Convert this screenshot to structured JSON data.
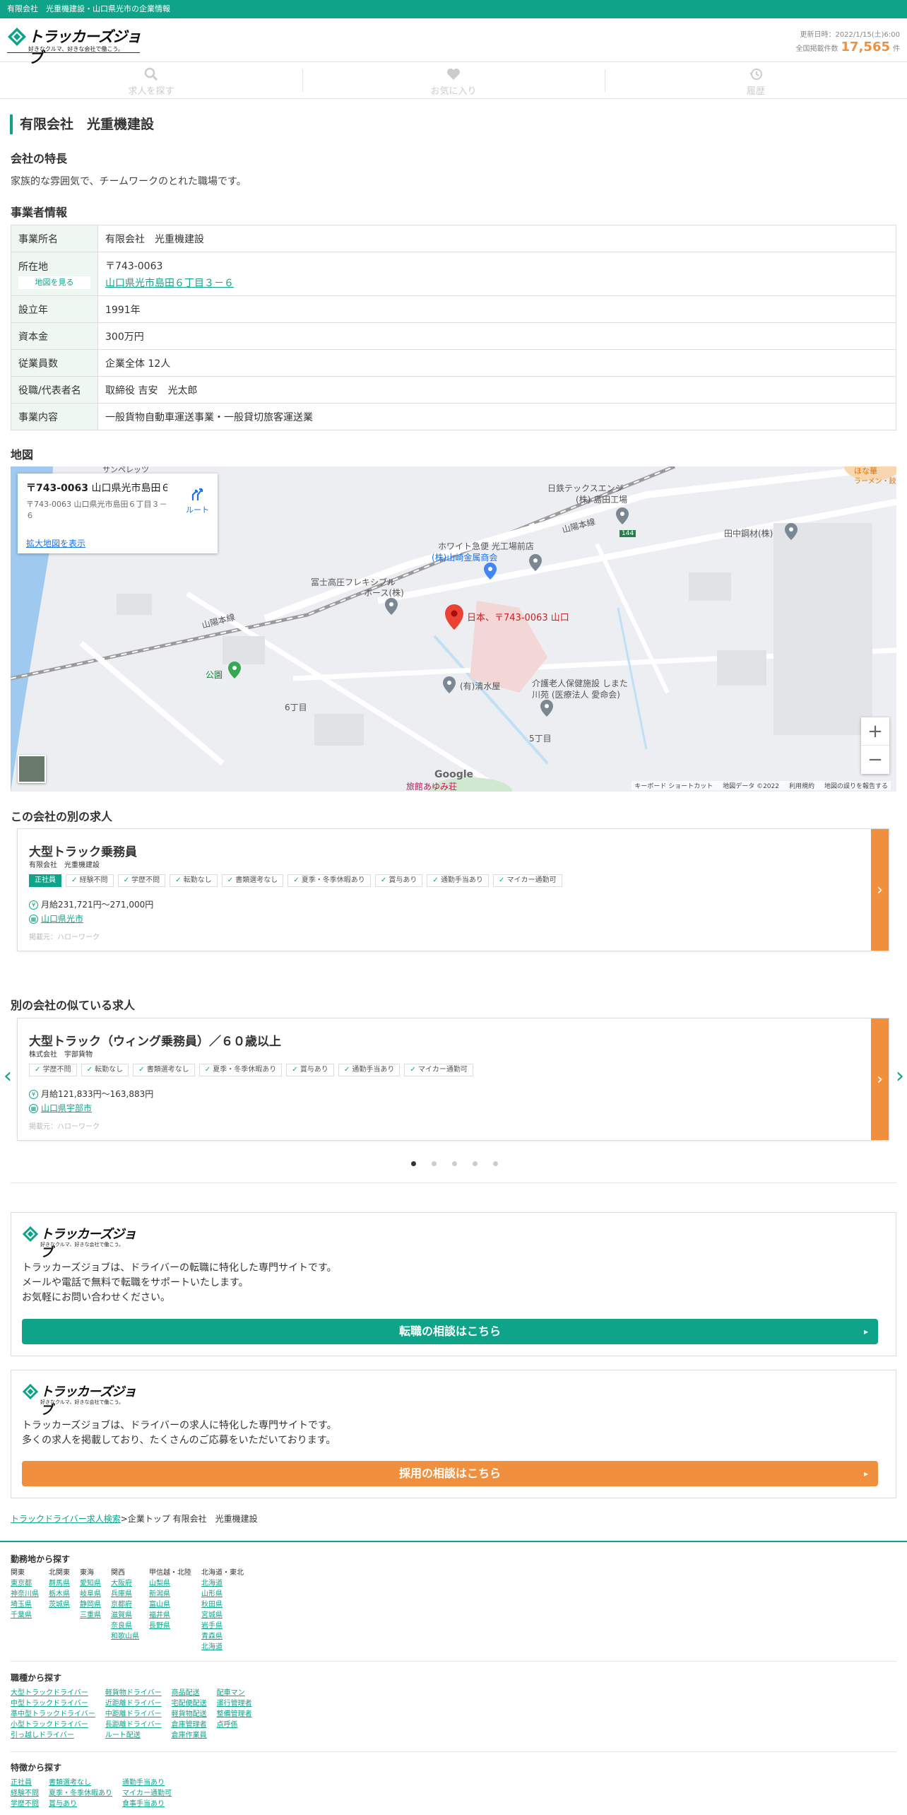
{
  "topbar": {
    "text": "有限会社　光重機建設・山口県光市の企業情報"
  },
  "header": {
    "logo_text": "トラッカーズジョブ",
    "logo_tagline": "好きなクルマ、好きな会社で働こう。",
    "updated": "更新日時：2022/1/15(土)6:00",
    "count_label": "全国掲載件数",
    "count_value": "17,565",
    "count_unit": "件"
  },
  "nav": [
    {
      "label": "求人を探す",
      "icon": "search-icon"
    },
    {
      "label": "お気に入り",
      "icon": "heart-icon"
    },
    {
      "label": "履歴",
      "icon": "history-icon"
    }
  ],
  "company": {
    "title": "有限会社　光重機建設",
    "feature_heading": "会社の特長",
    "feature_text": "家族的な雰囲気で、チームワークのとれた職場です。",
    "info_heading": "事業者情報",
    "rows": [
      {
        "label": "事業所名",
        "value": "有限会社　光重機建設"
      },
      {
        "label": "所在地",
        "postal": "〒743-0063",
        "address": "山口県光市島田６丁目３－６",
        "map_button": "地図を見る"
      },
      {
        "label": "設立年",
        "value": "1991年"
      },
      {
        "label": "資本金",
        "value": "300万円"
      },
      {
        "label": "従業員数",
        "value": "企業全体 12人"
      },
      {
        "label": "役職/代表者名",
        "value": "取締役 吉安　光太郎"
      },
      {
        "label": "事業内容",
        "value": "一般貨物自動車運送事業・一般貸切旅客運送業"
      }
    ]
  },
  "map": {
    "heading": "地図",
    "card_title_bold": "〒743-0063",
    "card_title_rest": " 山口県光市島田６...",
    "card_address": "〒743-0063 山口県光市島田６丁目３－６",
    "route": "ルート",
    "enlarge": "拡大地図を表示",
    "pin_label": "日本、〒743-0063 山口",
    "labels": {
      "nittetsu": "日鉄テックスエンジ",
      "nittetsu2": "(株) 島田工場",
      "white": "ホワイト急便 光工場前店",
      "yamasaki": "(株)山崎金属商会",
      "fuji": "冨士高圧フレキシブル",
      "fuji2": "ホース(株)",
      "tanaka": "田中鋼材(株)",
      "park": "公園",
      "shimizu": "(有)清水屋",
      "kaigo": "介護老人保健施設 しまた",
      "kaigo2": "川苑 (医療法人 愛命会)",
      "chome6": "6丁目",
      "chome5": "5丁目",
      "line1": "山陽本線",
      "line2": "山陽本線",
      "sunpet": "サンペレッツ",
      "ryokan": "旅館あゆみ荘",
      "hotplace": "ほな華",
      "ramen": "ラーメン・餃",
      "route144": "144",
      "google": "Google"
    },
    "attribution": [
      "キーボード ショートカット",
      "地図データ ©2022",
      "利用規約",
      "地図の誤りを報告する"
    ]
  },
  "other_jobs": {
    "heading": "この会社の別の求人",
    "job": {
      "title": "大型トラック乗務員",
      "company": "有限会社　光重機建設",
      "tags": [
        "正社員",
        "経験不問",
        "学歴不問",
        "転勤なし",
        "書類選考なし",
        "夏季・冬季休暇あり",
        "賞与あり",
        "通勤手当あり",
        "マイカー通勤可"
      ],
      "salary": "月給231,721円〜271,000円",
      "place": "山口県光市",
      "source": "掲載元：ハローワーク"
    }
  },
  "similar_jobs": {
    "heading": "別の会社の似ている求人",
    "job": {
      "title": "大型トラック（ウィング乗務員）／６０歳以上",
      "company": "株式会社　宇部貨物",
      "tags": [
        "学歴不問",
        "転勤なし",
        "書類選考なし",
        "夏季・冬季休暇あり",
        "賞与あり",
        "通勤手当あり",
        "マイカー通勤可"
      ],
      "salary": "月給121,833円〜163,883円",
      "place": "山口県宇部市",
      "source": "掲載元：ハローワーク"
    }
  },
  "promo1": {
    "lines": [
      "トラッカーズジョブは、ドライバーの転職に特化した専門サイトです。",
      "メールや電話で無料で転職をサポートいたします。",
      "お気軽にお問い合わせください。"
    ],
    "button": "転職の相談はこちら"
  },
  "promo2": {
    "lines": [
      "トラッカーズジョブは、ドライバーの求人に特化した専門サイトです。",
      "多くの求人を掲載しており、たくさんのご応募をいただいております。"
    ],
    "button": "採用の相談はこちら"
  },
  "breadcrumb": {
    "link": "トラックドライバー求人検索",
    "rest": ">企業トップ 有限会社　光重機建設"
  },
  "footer": {
    "area_heading": "勤務地から探す",
    "areas": [
      {
        "head": "関東",
        "items": [
          "東京都",
          "神奈川県",
          "埼玉県",
          "千葉県"
        ]
      },
      {
        "head": "北関東",
        "items": [
          "群馬県",
          "栃木県",
          "茨城県"
        ]
      },
      {
        "head": "東海",
        "items": [
          "愛知県",
          "岐阜県",
          "静岡県",
          "三重県"
        ]
      },
      {
        "head": "関西",
        "items": [
          "大阪府",
          "兵庫県",
          "京都府",
          "滋賀県",
          "奈良県",
          "和歌山県"
        ]
      },
      {
        "head": "甲信越・北陸",
        "items": [
          "山梨県",
          "新潟県",
          "富山県",
          "福井県",
          "長野県"
        ]
      },
      {
        "head": "北海道・東北",
        "items": [
          "北海道",
          "山形県",
          "秋田県",
          "宮城県",
          "岩手県",
          "青森県",
          "北海道"
        ]
      }
    ],
    "type_heading": "職種から探す",
    "types": [
      [
        "大型トラックドライバー",
        "中型トラックドライバー",
        "準中型トラックドライバー",
        "小型トラックドライバー",
        "引っ越しドライバー"
      ],
      [
        "軽貨物ドライバー",
        "近距離ドライバー",
        "中距離ドライバー",
        "長距離ドライバー",
        "ルート配送"
      ],
      [
        "商品配送",
        "宅配便配送",
        "軽貨物配送",
        "倉庫管理者",
        "倉庫作業員"
      ],
      [
        "配車マン",
        "運行管理者",
        "整備管理者",
        "点呼係"
      ]
    ],
    "feature_heading": "特徴から探す",
    "features": [
      [
        "正社員",
        "経験不問",
        "学歴不問"
      ],
      [
        "書類選考なし",
        "夏季・冬季休暇あり",
        "賞与あり"
      ],
      [
        "通勤手当あり",
        "マイカー通勤可",
        "食事手当あり"
      ]
    ]
  }
}
